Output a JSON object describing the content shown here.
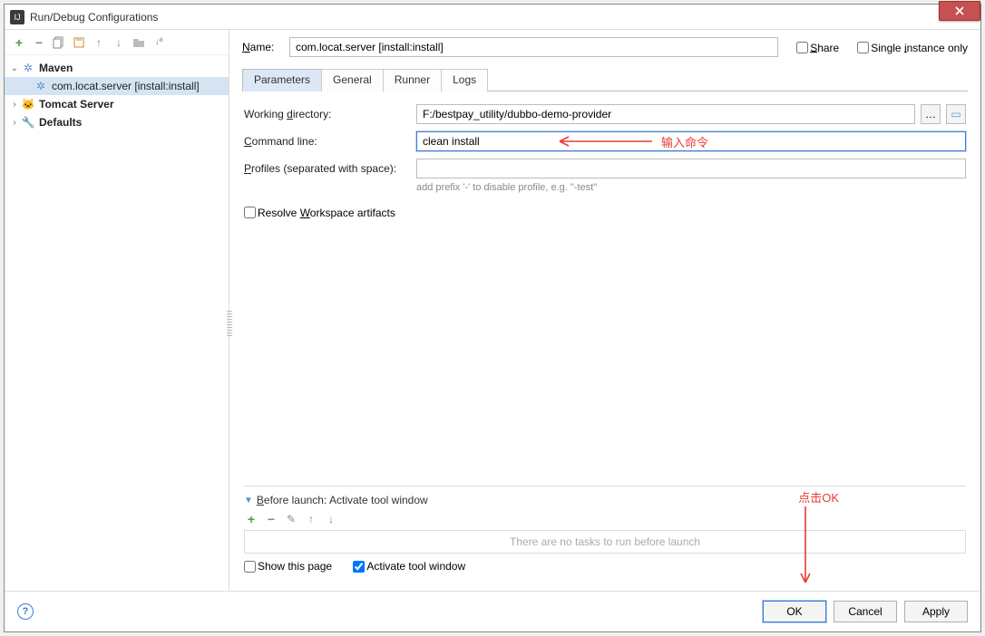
{
  "title": "Run/Debug Configurations",
  "tree": {
    "maven": "Maven",
    "maven_child": "com.locat.server [install:install]",
    "tomcat": "Tomcat Server",
    "defaults": "Defaults"
  },
  "name_label": "Name:",
  "name_value": "com.locat.server [install:install]",
  "share_label": "Share",
  "single_instance_label": "Single instance only",
  "tabs": {
    "parameters": "Parameters",
    "general": "General",
    "runner": "Runner",
    "logs": "Logs"
  },
  "form": {
    "working_dir_label": "Working directory:",
    "working_dir_value": "F:/bestpay_utility/dubbo-demo-provider",
    "command_line_label": "Command line:",
    "command_line_value": "clean install",
    "profiles_label": "Profiles (separated with space):",
    "profiles_value": "",
    "profiles_hint": "add prefix '-' to disable profile, e.g. \"-test\"",
    "resolve_workspace": "Resolve Workspace artifacts"
  },
  "before_launch": {
    "header": "Before launch: Activate tool window",
    "empty_text": "There are no tasks to run before launch",
    "show_this_page": "Show this page",
    "activate_tool_window": "Activate tool window"
  },
  "buttons": {
    "ok": "OK",
    "cancel": "Cancel",
    "apply": "Apply"
  },
  "annotations": {
    "cmd_hint": "输入命令",
    "ok_hint": "点击OK"
  }
}
